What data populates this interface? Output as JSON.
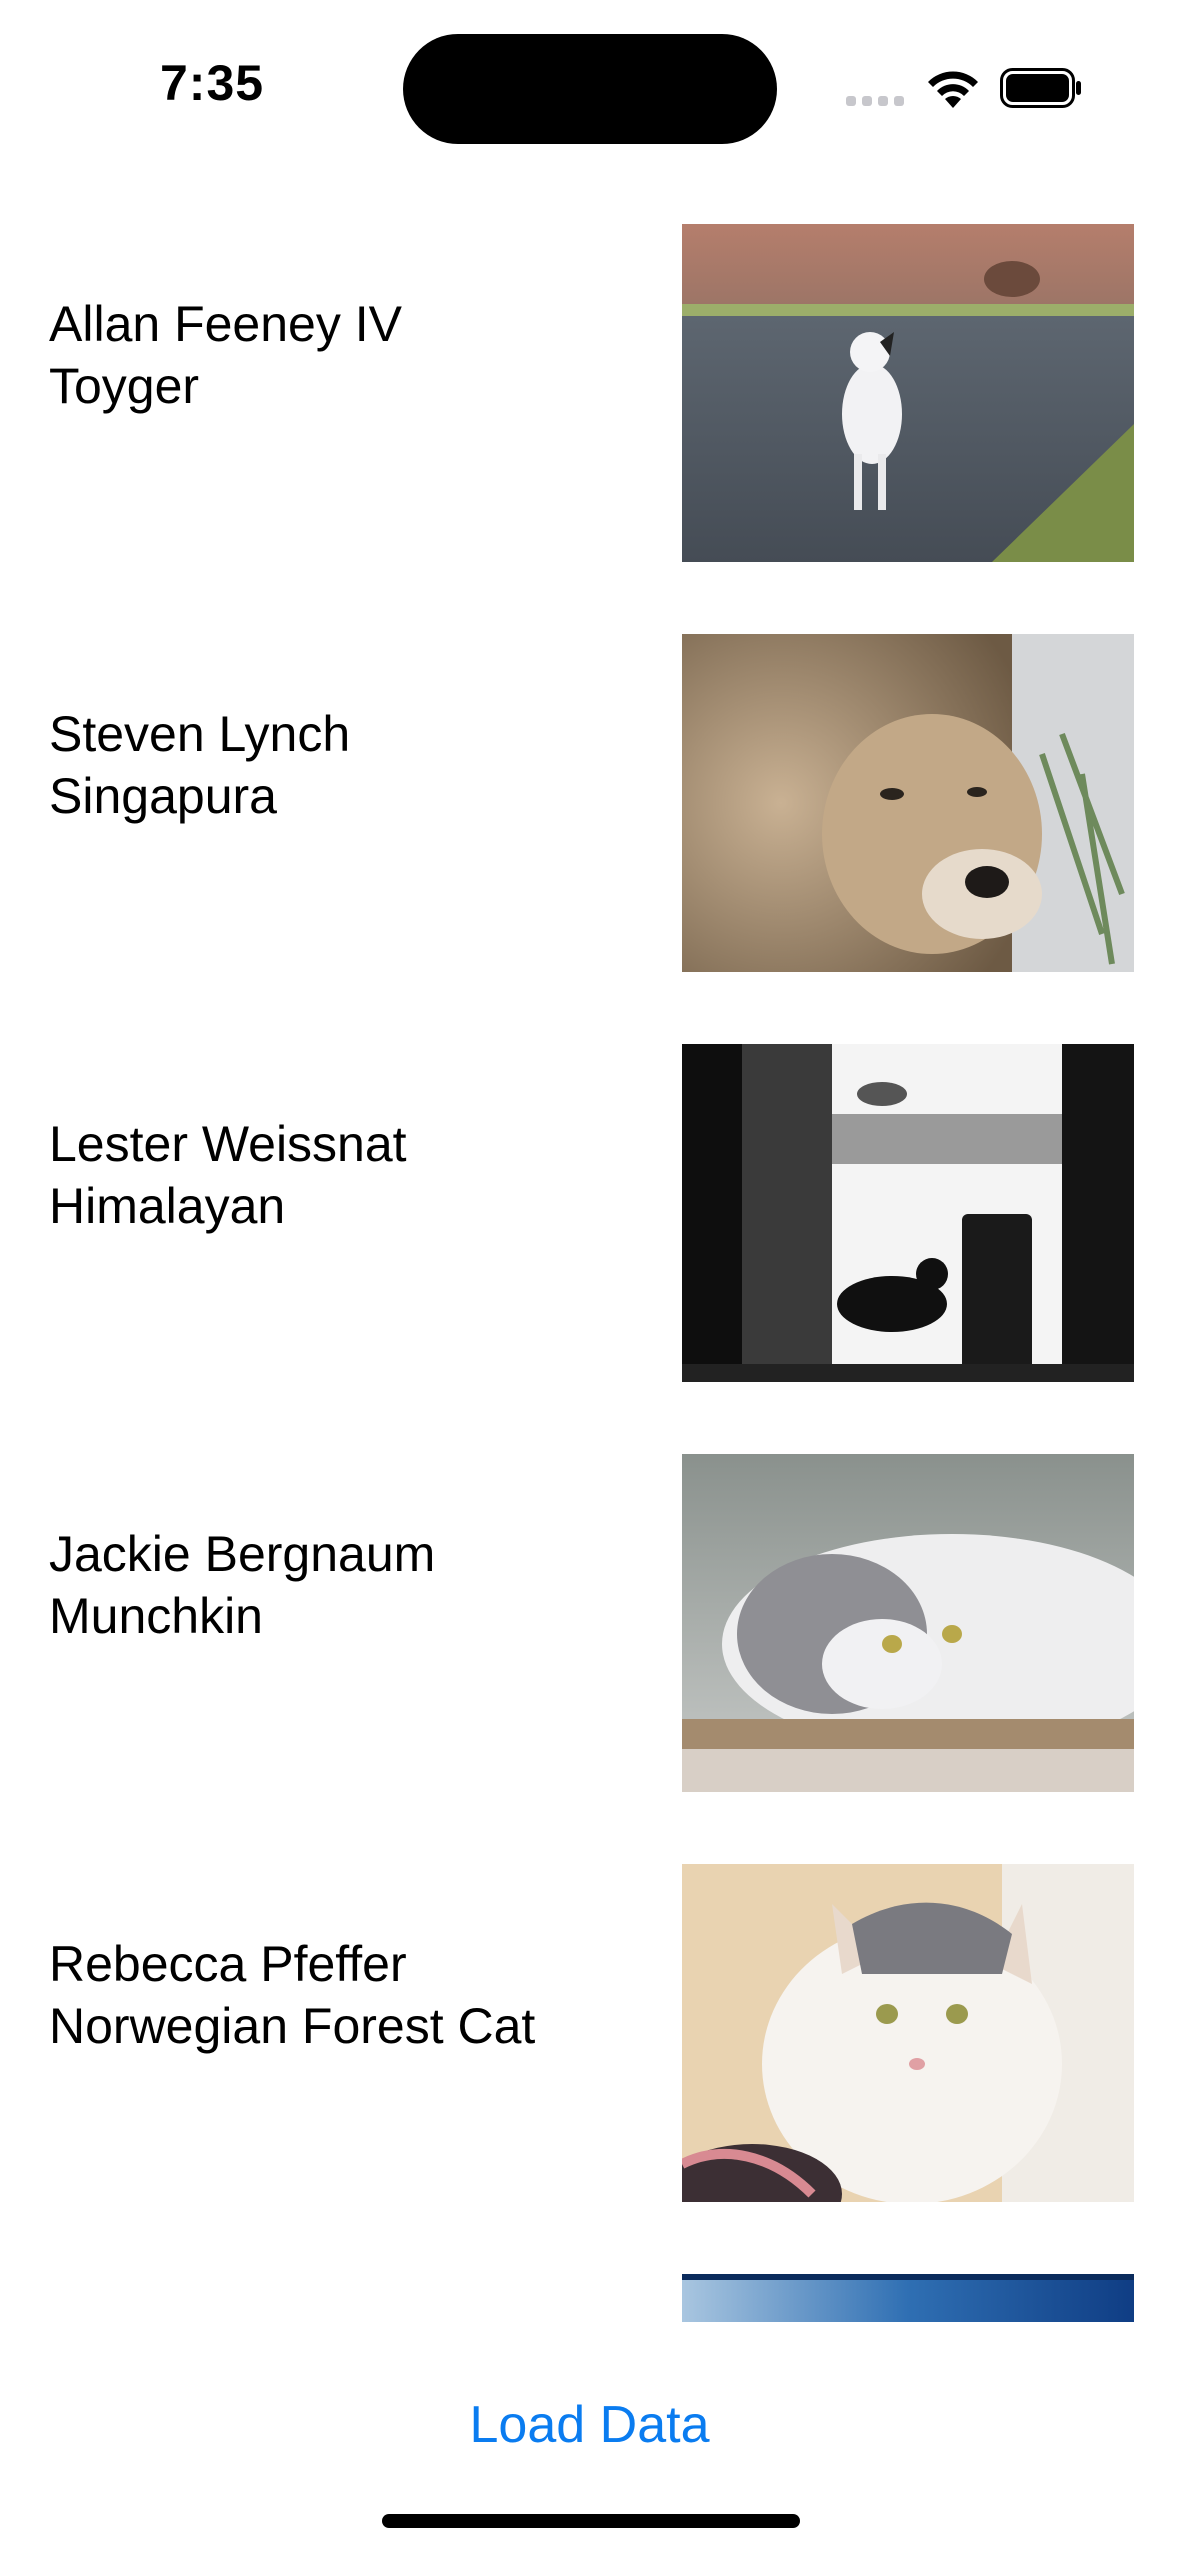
{
  "status_bar": {
    "time": "7:35",
    "icons": [
      "cellular-signal-icon",
      "wifi-icon",
      "battery-icon"
    ]
  },
  "list": {
    "items": [
      {
        "name": "Allan Feeney IV",
        "breed": "Toyger",
        "image": "white-cat-on-road-photo"
      },
      {
        "name": "Steven Lynch",
        "breed": "Singapura",
        "image": "lion-face-photo"
      },
      {
        "name": "Lester Weissnat",
        "breed": "Himalayan",
        "image": "cats-in-doorway-bw-photo"
      },
      {
        "name": "Jackie Bergnaum",
        "breed": "Munchkin",
        "image": "grey-white-cat-resting-photo"
      },
      {
        "name": "Rebecca Pfeffer",
        "breed": "Norwegian Forest Cat",
        "image": "fluffy-white-cat-photo"
      },
      {
        "name": "",
        "breed": "",
        "image": "blue-abstract-photo"
      }
    ]
  },
  "footer": {
    "load_button_label": "Load Data",
    "accent_color": "#0a7cf0"
  }
}
